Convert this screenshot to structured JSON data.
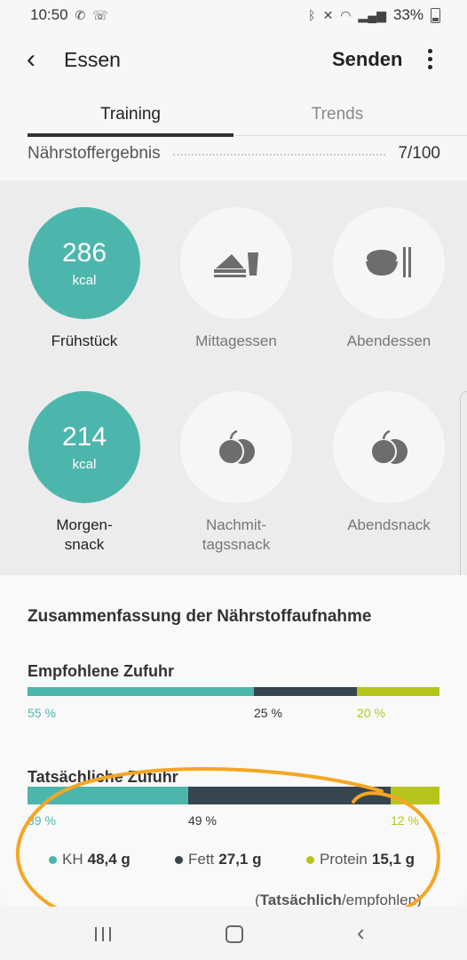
{
  "status": {
    "time": "10:50",
    "battery": "33%"
  },
  "header": {
    "title": "Essen",
    "send_label": "Senden"
  },
  "tabs": [
    {
      "label": "Training"
    },
    {
      "label": "Trends"
    }
  ],
  "score": {
    "label": "Nährstoffergebnis",
    "value": "7/100"
  },
  "meals": [
    {
      "value": "286",
      "unit": "kcal",
      "label": "Frühstück"
    },
    {
      "icon": "sandwich-icon",
      "label": "Mittagessen"
    },
    {
      "icon": "rice-bowl-icon",
      "label": "Abendessen"
    },
    {
      "value": "214",
      "unit": "kcal",
      "label_line1": "Morgen-",
      "label_line2": "snack"
    },
    {
      "icon": "fruit-icon",
      "label_line1": "Nachmit-",
      "label_line2": "tagssnack"
    },
    {
      "icon": "fruit-icon",
      "label": "Abendsnack"
    }
  ],
  "summary": {
    "title": "Zusammenfassung der Nährstoffaufnahme",
    "recommended": {
      "title": "Empfohlene Zufuhr",
      "kh": "55 %",
      "fett": "25 %",
      "protein": "20 %"
    },
    "actual": {
      "title": "Tatsächliche Zufuhr",
      "kh": "39 %",
      "fett": "49 %",
      "protein": "12 %"
    },
    "legend": {
      "kh_label": "KH",
      "kh_value": "48,4 g",
      "fett_label": "Fett",
      "fett_value": "27,1 g",
      "protein_label": "Protein",
      "protein_value": "15,1 g"
    },
    "note_open": "(",
    "note_bold": "Tatsächlich",
    "note_rest": "/empfohlen)"
  },
  "colors": {
    "kh": "#4db6ac",
    "fett": "#36454f",
    "protein": "#b5c51c",
    "annotation": "#f5a623"
  }
}
